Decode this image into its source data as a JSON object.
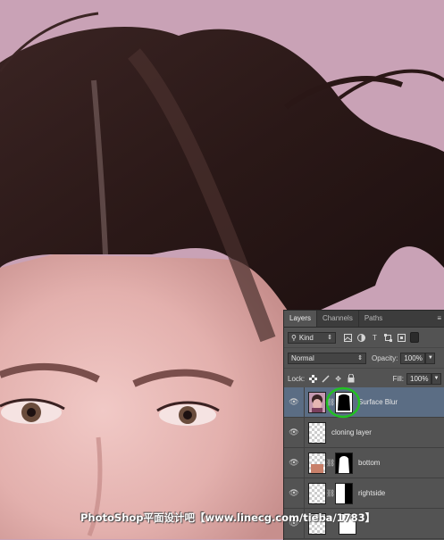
{
  "panel": {
    "tabs": [
      "Layers",
      "Channels",
      "Paths"
    ],
    "active_tab": "Layers",
    "menu_glyph": "≡",
    "filter": {
      "kind_label": "Kind",
      "icons": [
        "image-filter-icon",
        "adjustment-filter-icon",
        "type-filter-icon",
        "shape-filter-icon",
        "smart-object-filter-icon"
      ]
    },
    "blend_mode": "Normal",
    "opacity_label": "Opacity:",
    "opacity_value": "100%",
    "lock_label": "Lock:",
    "fill_label": "Fill:",
    "fill_value": "100%",
    "layers": [
      {
        "name": "Surface Blur",
        "selected": true,
        "has_mask": true
      },
      {
        "name": "cloning layer",
        "selected": false,
        "has_mask": false
      },
      {
        "name": "bottom",
        "selected": false,
        "has_mask": true
      },
      {
        "name": "rightside",
        "selected": false,
        "has_mask": true
      }
    ]
  },
  "watermark": "PhotoShop平面设计吧【www.linecg.com/tieba/1783】",
  "colors": {
    "background": "#c9a2b6",
    "panel": "#535353",
    "selection": "#5b6d84",
    "highlight_ring": "#22c022"
  }
}
